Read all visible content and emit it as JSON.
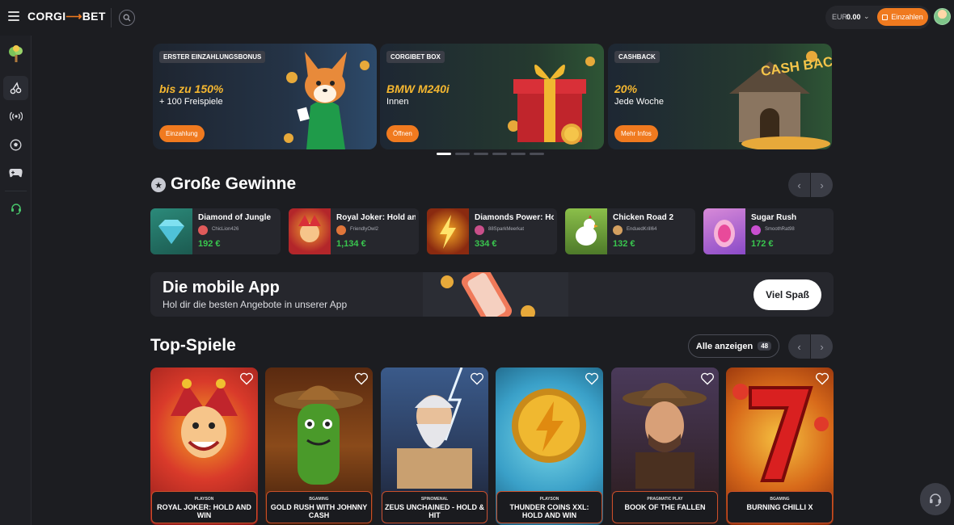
{
  "header": {
    "logo": {
      "part1": "CORGI",
      "part2": "BET"
    },
    "wallet": {
      "currency": "EUR",
      "balance": "0.00"
    },
    "deposit_label": "Einzahlen"
  },
  "sidebar": {
    "items": [
      {
        "name": "home",
        "icon": "tree-icon"
      },
      {
        "name": "casino",
        "icon": "cherries-icon"
      },
      {
        "name": "live",
        "icon": "broadcast-icon"
      },
      {
        "name": "sports",
        "icon": "soccer-ball-icon"
      },
      {
        "name": "esports",
        "icon": "gamepad-icon"
      },
      {
        "name": "support",
        "icon": "headset-icon"
      }
    ]
  },
  "banners": [
    {
      "tag": "ERSTER EINZAHLUNGSBONUS",
      "headline": "bis zu 150%",
      "sub": "+ 100 Freispiele",
      "button": "Einzahlung"
    },
    {
      "tag": "CORGIBET BOX",
      "headline": "BMW M240i",
      "sub": "Innen",
      "button": "Öffnen"
    },
    {
      "tag": "CASHBACK",
      "headline": "20%",
      "sub": "Jede Woche",
      "button": "Mehr Infos",
      "art_text": "CASH BACK"
    }
  ],
  "big_wins": {
    "title": "Große Gewinne",
    "items": [
      {
        "game": "Diamond of Jungle",
        "user": "ChicLion426",
        "amount": "192 €"
      },
      {
        "game": "Royal Joker: Hold and Win",
        "user": "FriendlyOwl2",
        "amount": "1,134 €"
      },
      {
        "game": "Diamonds Power: Hold and Win",
        "user": "88SparkMeerkat",
        "amount": "334 €"
      },
      {
        "game": "Chicken Road 2",
        "user": "EnduedKrill64",
        "amount": "132 €"
      },
      {
        "game": "Sugar Rush",
        "user": "SmoothRat98",
        "amount": "172 €"
      }
    ]
  },
  "app_banner": {
    "title": "Die mobile App",
    "subtitle": "Hol dir die besten Angebote in unserer App",
    "button": "Viel Spaß"
  },
  "top_games": {
    "title": "Top-Spiele",
    "show_all": "Alle anzeigen",
    "count": "48",
    "items": [
      {
        "provider": "PLAYSON",
        "title": "ROYAL JOKER: HOLD AND WIN"
      },
      {
        "provider": "BGAMING",
        "title": "GOLD RUSH WITH JOHNNY CASH"
      },
      {
        "provider": "SPINOMENAL",
        "title": "ZEUS UNCHAINED - HOLD & HIT"
      },
      {
        "provider": "PLAYSON",
        "title": "THUNDER COINS XXL: HOLD AND WIN"
      },
      {
        "provider": "PRAGMATIC PLAY",
        "title": "BOOK OF THE FALLEN"
      },
      {
        "provider": "BGAMING",
        "title": "BURNING CHILLI X"
      }
    ]
  }
}
